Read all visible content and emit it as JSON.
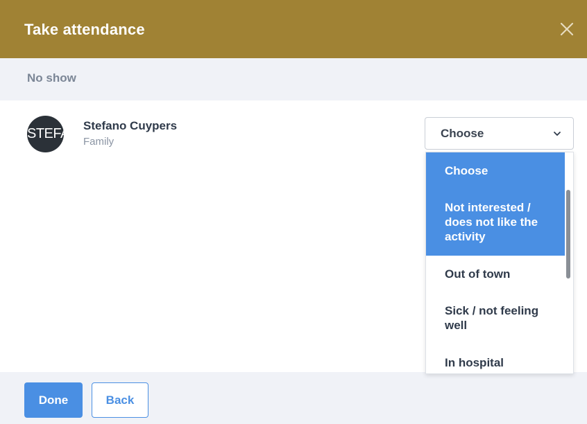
{
  "header": {
    "title": "Take attendance",
    "color": "#a08234",
    "close_icon": "close-icon"
  },
  "section": {
    "label": "No show"
  },
  "person": {
    "avatar_text": "STEFA",
    "name": "Stefano Cuypers",
    "role": "Family"
  },
  "select": {
    "value": "Choose",
    "chevron_icon": "chevron-down-icon"
  },
  "dropdown": {
    "options": [
      {
        "lines": [
          "Choose"
        ],
        "highlighted": true
      },
      {
        "lines": [
          "Not interested /",
          "does not like the",
          "activity"
        ],
        "highlighted": true
      },
      {
        "lines": [
          "Out of town"
        ],
        "highlighted": false
      },
      {
        "lines": [
          "Sick / not feeling",
          "well"
        ],
        "highlighted": false
      },
      {
        "lines": [
          "In hospital"
        ],
        "highlighted": false
      }
    ],
    "highlight_color": "#4a8fe3"
  },
  "footer": {
    "done_label": "Done",
    "back_label": "Back"
  }
}
